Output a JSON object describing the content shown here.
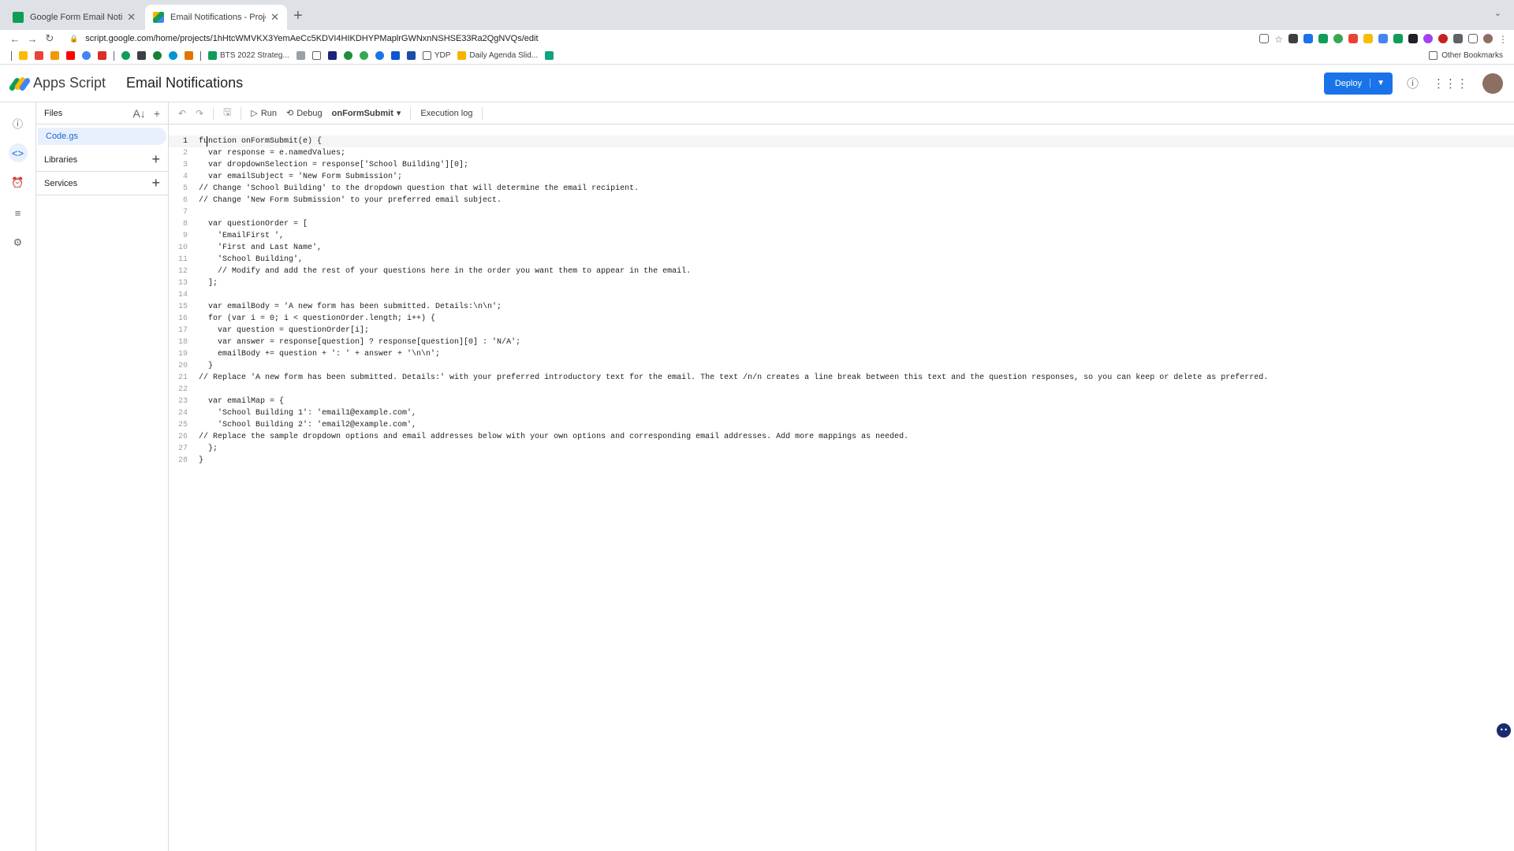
{
  "browser": {
    "tabs": [
      {
        "title": "Google Form Email Notificatio",
        "favicon_color": "#0f9d58"
      },
      {
        "title": "Email Notifications - Project Ed",
        "favicon_color": "#f4b400"
      }
    ],
    "url": "script.google.com/home/projects/1hHtcWMVKX3YemAeCc5KDVI4HIKDHYPMaplrGWNxnNSHSE33Ra2QgNVQs/edit",
    "bookmarks": [
      {
        "label": "BTS 2022 Strateg...",
        "color": "#0f9d58"
      },
      {
        "label": "YDP",
        "color": "#5f6368"
      },
      {
        "label": "Daily Agenda Slid...",
        "color": "#f4b400"
      }
    ],
    "other_bookmarks": "Other Bookmarks"
  },
  "header": {
    "app_name": "Apps Script",
    "project_name": "Email Notifications",
    "deploy_label": "Deploy"
  },
  "files_panel": {
    "title": "Files",
    "files": [
      "Code.gs"
    ],
    "libraries_label": "Libraries",
    "services_label": "Services"
  },
  "toolbar": {
    "run_label": "Run",
    "debug_label": "Debug",
    "function_name": "onFormSubmit",
    "execution_log_label": "Execution log"
  },
  "code_lines": [
    "function onFormSubmit(e) {",
    "  var response = e.namedValues;",
    "  var dropdownSelection = response['School Building'][0];",
    "  var emailSubject = 'New Form Submission';",
    "// Change 'School Building' to the dropdown question that will determine the email recipient.",
    "// Change 'New Form Submission' to your preferred email subject.",
    "",
    "  var questionOrder = [",
    "    'EmailFirst ',",
    "    'First and Last Name',",
    "    'School Building',",
    "    // Modify and add the rest of your questions here in the order you want them to appear in the email.",
    "  ];",
    "",
    "  var emailBody = 'A new form has been submitted. Details:\\n\\n';",
    "  for (var i = 0; i < questionOrder.length; i++) {",
    "    var question = questionOrder[i];",
    "    var answer = response[question] ? response[question][0] : 'N/A';",
    "    emailBody += question + ': ' + answer + '\\n\\n';",
    "  }",
    "// Replace 'A new form has been submitted. Details:' with your preferred introductory text for the email. The text /n/n creates a line break between this text and the question responses, so you can keep or delete as preferred.",
    "",
    "  var emailMap = {",
    "    'School Building 1': 'email1@example.com',",
    "    'School Building 2': 'email2@example.com',",
    "// Replace the sample dropdown options and email addresses below with your own options and corresponding email addresses. Add more mappings as needed.",
    "  };",
    "}"
  ]
}
